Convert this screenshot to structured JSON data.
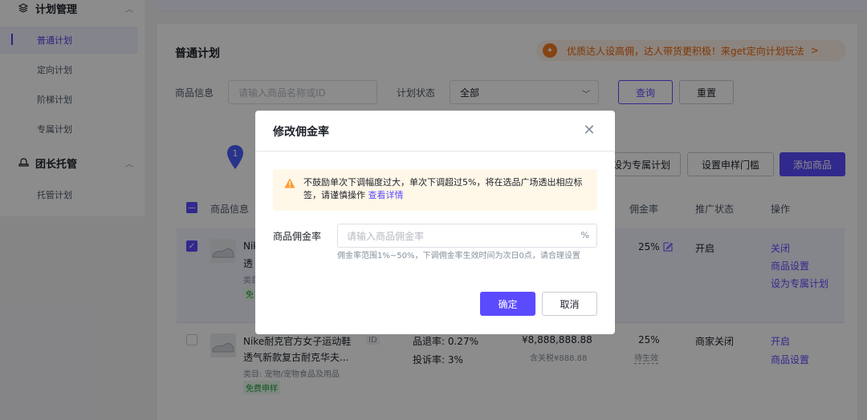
{
  "sidebar": {
    "group1": {
      "label": "计划管理",
      "icon": "layers-icon"
    },
    "items": [
      {
        "label": "普通计划"
      },
      {
        "label": "定向计划"
      },
      {
        "label": "阶梯计划"
      },
      {
        "label": "专属计划"
      }
    ],
    "group2": {
      "label": "团长托管",
      "icon": "hat-icon"
    },
    "items2": [
      {
        "label": "托管计划"
      }
    ]
  },
  "page": {
    "title": "普通计划",
    "promo": "优质达人设高佣，达人带货更积极！来get定向计划玩法",
    "promo_arrow": ">"
  },
  "filters": {
    "product_label": "商品信息",
    "product_placeholder": "请输入商品名称或ID",
    "status_label": "计划状态",
    "status_value": "全部",
    "query_button": "查询",
    "reset_button": "重置"
  },
  "toolbar": {
    "set_exclusive": "设为专属计划",
    "set_sample": "设置申样门槛",
    "add_product": "添加商品",
    "pin_number": "1"
  },
  "table": {
    "headers": {
      "product": "商品信息",
      "commission": "佣金率",
      "status": "推广状态",
      "actions": "操作"
    },
    "row1": {
      "name_line1": "Nik",
      "name_line2": "透",
      "category_frag": "类目",
      "tag_frag": "免",
      "commission": "25%",
      "status": "开启",
      "actions": [
        "关闭",
        "商品设置",
        "设为专属计划"
      ]
    },
    "row2": {
      "name_line1": "Nike耐克官方女子运动鞋",
      "name_line2": "透气新款复古耐克华夫...",
      "id_tag": "ID",
      "category": "类目: 宠物/宠物食品及用品",
      "tag": "免费申样",
      "refund_rate": "品退率: 0.27%",
      "complaint_rate": "投诉率: 3%",
      "price": "¥8,888,888.88",
      "tax_price": "含关税¥888.88",
      "commission": "25%",
      "commission_note": "待生效",
      "status": "商家关闭",
      "actions": [
        "开启",
        "商品设置"
      ]
    }
  },
  "modal": {
    "title": "修改佣金率",
    "warning_text": "不鼓励单次下调幅度过大，单次下调超过5%，将在选品广场透出相应标签，请谨慎操作",
    "warning_link": "查看详情",
    "field_label": "商品佣金率",
    "field_placeholder": "请输入商品佣金率",
    "field_suffix": "%",
    "hint": "佣金率范围1%~50%，下调佣金率生效时间为次日0点，请合理设置",
    "ok_button": "确定",
    "cancel_button": "取消"
  },
  "colors": {
    "primary": "#5b4bff",
    "warning_bg": "#fff7e8",
    "promo": "#e8650a",
    "tag_green": "#1d9c3a"
  }
}
